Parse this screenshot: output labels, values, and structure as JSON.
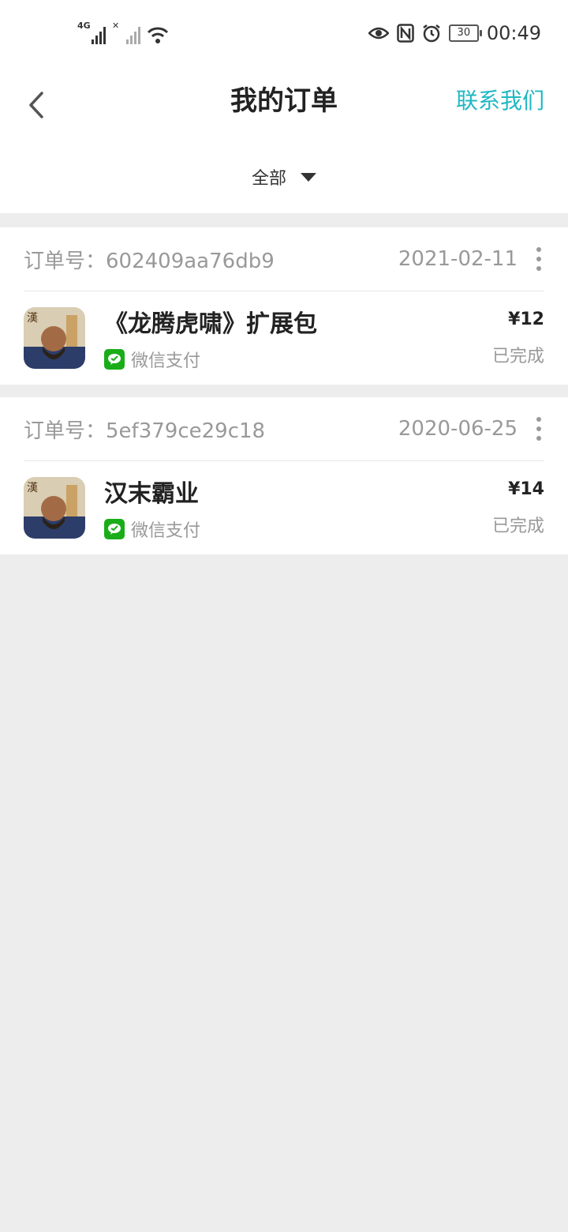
{
  "status_bar": {
    "network": "4G",
    "battery": "30",
    "time": "00:49"
  },
  "header": {
    "title": "我的订单",
    "contact": "联系我们"
  },
  "filter": {
    "label": "全部"
  },
  "orders": [
    {
      "order_no": "订单号：602409aa76db9",
      "date": "2021-02-11",
      "name": "《龙腾虎啸》扩展包",
      "payment": "微信支付",
      "price": "¥12",
      "status": "已完成"
    },
    {
      "order_no": "订单号：5ef379ce29c18",
      "date": "2020-06-25",
      "name": "汉末霸业",
      "payment": "微信支付",
      "price": "¥14",
      "status": "已完成"
    }
  ],
  "colors": {
    "accent": "#1fb8c3",
    "wechat": "#1aad19",
    "background": "#ededed"
  },
  "icons": [
    "back-arrow-icon",
    "caret-down-icon",
    "more-vertical-icon",
    "wechat-pay-icon",
    "game-thumbnail-image"
  ]
}
